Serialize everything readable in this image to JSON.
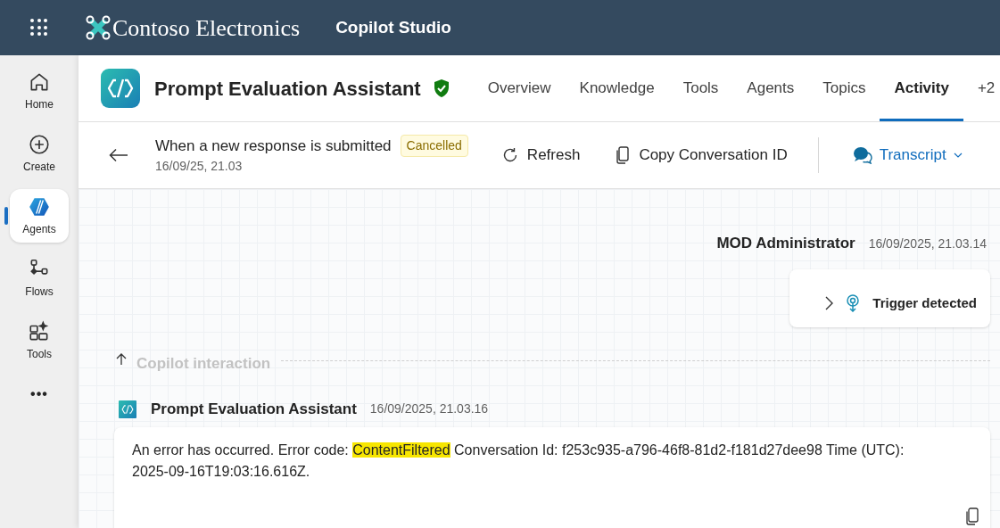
{
  "top_bar": {
    "brand": "Contoso Electronics",
    "product": "Copilot Studio"
  },
  "sidebar": {
    "items": [
      {
        "label": "Home",
        "kind": "home",
        "selected": false
      },
      {
        "label": "Create",
        "kind": "create",
        "selected": false
      },
      {
        "label": "Agents",
        "kind": "agents",
        "selected": true
      },
      {
        "label": "Flows",
        "kind": "flows",
        "selected": false
      },
      {
        "label": "Tools",
        "kind": "tools",
        "selected": false
      }
    ],
    "more": "•••"
  },
  "agent": {
    "name": "Prompt Evaluation Assistant",
    "verified": true
  },
  "tabs": [
    {
      "label": "Overview",
      "selected": false
    },
    {
      "label": "Knowledge",
      "selected": false
    },
    {
      "label": "Tools",
      "selected": false
    },
    {
      "label": "Agents",
      "selected": false
    },
    {
      "label": "Topics",
      "selected": false
    },
    {
      "label": "Activity",
      "selected": true
    },
    {
      "label": "+2",
      "selected": false
    }
  ],
  "session": {
    "title": "When a new response is submitted",
    "status": "Cancelled",
    "date": "16/09/25, 21.03"
  },
  "toolbar": {
    "refresh": "Refresh",
    "copy": "Copy Conversation ID",
    "transcript": "Transcript"
  },
  "conversation": {
    "user": {
      "name": "MOD Administrator",
      "time": "16/09/2025, 21.03.14",
      "event": "Trigger detected",
      "expanded": false
    },
    "divider": "Copilot interaction",
    "bot": {
      "name": "Prompt Evaluation Assistant",
      "time": "16/09/2025, 21.03.16",
      "message": {
        "before": "An error has occurred. Error code: ",
        "highlighted": "ContentFiltered",
        "after": " Conversation Id: f253c935-a796-46f8-81d2-f181d27dee98 Time (UTC): 2025-09-16T19:03:16.616Z."
      }
    }
  }
}
